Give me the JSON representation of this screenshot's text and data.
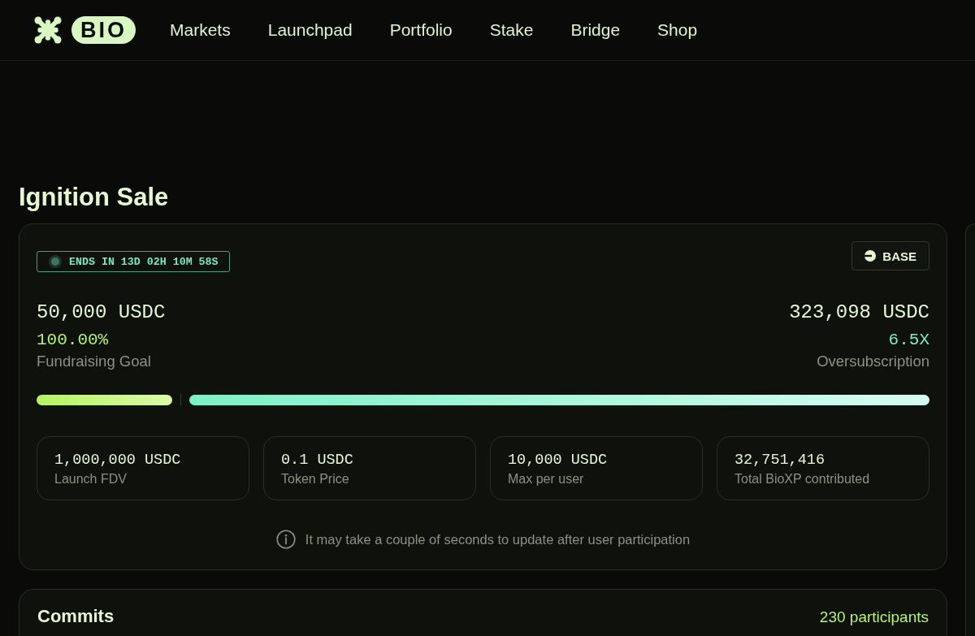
{
  "nav": {
    "logo": "BIO",
    "links": [
      "Markets",
      "Launchpad",
      "Portfolio",
      "Stake",
      "Bridge",
      "Shop"
    ]
  },
  "page_title": "Ignition Sale",
  "sale_card": {
    "countdown": "ENDS IN 13D 02H 10M 58S",
    "network": "BASE",
    "goal": {
      "amount": "50,000 USDC",
      "percent": "100.00%",
      "label": "Fundraising Goal"
    },
    "raised": {
      "amount": "323,098 USDC",
      "multiple": "6.5X",
      "label": "Oversubscription"
    },
    "progress": {
      "segments": [
        {
          "kind": "goal",
          "level": 0.155
        },
        {
          "kind": "oversubscription",
          "level": 0.845
        }
      ]
    },
    "stats": [
      {
        "value": "1,000,000 USDC",
        "label": "Launch FDV"
      },
      {
        "value": "0.1 USDC",
        "label": "Token Price"
      },
      {
        "value": "10,000 USDC",
        "label": "Max per user"
      },
      {
        "value": "32,751,416",
        "label": "Total BioXP contributed"
      }
    ],
    "note": "It may take a couple of seconds to update after user participation"
  },
  "commits_card": {
    "title": "Commits",
    "participants": "230 participants"
  }
}
